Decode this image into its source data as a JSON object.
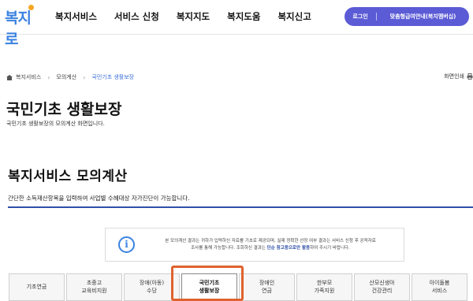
{
  "header": {
    "logo_text": "복지로",
    "nav": [
      "복지서비스",
      "서비스 신청",
      "복지지도",
      "복지도움",
      "복지신고"
    ],
    "login_label": "로그인",
    "pill_link_label": "맞춤형급여안내(복지멤버십)"
  },
  "breadcrumb": {
    "items": [
      "복지서비스",
      "모의계산"
    ],
    "current": "국민기초 생활보장",
    "print_label": "화면인쇄"
  },
  "page": {
    "title": "국민기초 생활보장",
    "subtitle": "국민기초 생활보장의 모의계산 화면입니다."
  },
  "section": {
    "title": "복지서비스 모의계산",
    "description": "간단한 소득재산항목을 입력하여 사업별 수혜대상 자가진단이 가능합니다."
  },
  "notice": {
    "line1": "본 모의계산 결과는 귀하가 입력하신 자료를 기초로 제공되며, 실제 정확한 선정 여부 결과는 서비스 신청 후 공적자료",
    "line2_pre": "조사를 통해 가능합니다. 조회하신 결과는 ",
    "line2_highlight": "단순 참고용으로만 활용",
    "line2_post": "하여 주시기 바랍니다."
  },
  "tabs": [
    {
      "line1": "기초연금",
      "line2": ""
    },
    {
      "line1": "초중고",
      "line2": "교육비지원"
    },
    {
      "line1": "장애(아동)",
      "line2": "수당"
    },
    {
      "line1": "국민기초",
      "line2": "생활보장"
    },
    {
      "line1": "장애인",
      "line2": "연금"
    },
    {
      "line1": "한부모",
      "line2": "가족지원"
    },
    {
      "line1": "산모신생아",
      "line2": "건강관리"
    },
    {
      "line1": "아이돌봄",
      "line2": "서비스"
    }
  ],
  "active_tab_index": 3,
  "colors": {
    "accent": "#5b5bd6",
    "link": "#3b6fd8",
    "section_rule": "#2f4fa8",
    "highlight_box": "#e0622e"
  }
}
